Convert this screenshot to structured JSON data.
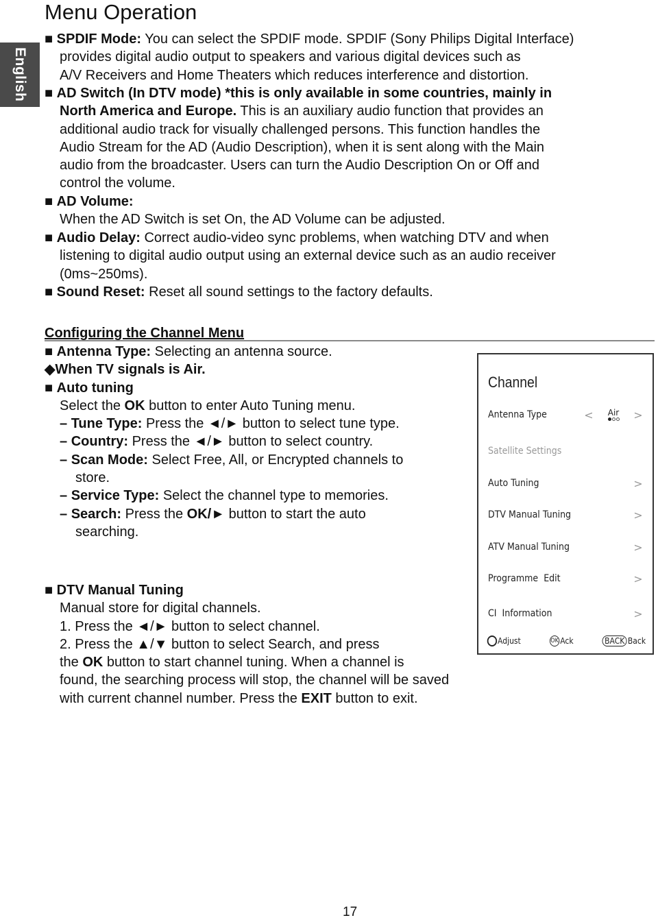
{
  "page": {
    "title": "Menu Operation",
    "language_tab": "English",
    "page_number": "17"
  },
  "sound_section": {
    "spdif": {
      "bullet": "■",
      "label": "SPDIF Mode:",
      "line1": " You can select the SPDIF mode. SPDIF (Sony Philips Digital Interface)",
      "line2": "provides digital audio output to speakers and various digital devices such as",
      "line3": "A/V Receivers and Home Theaters which reduces interference and distortion."
    },
    "ad_switch": {
      "bullet": "■",
      "label_line1": "AD Switch (In DTV mode) *this is only available in some countries, mainly in",
      "label_line2": "North America and Europe.",
      "line2_rest": " This is an auxiliary audio function that provides an",
      "line3": "additional audio track for visually challenged persons. This function handles the",
      "line4": "Audio Stream for the AD (Audio Description), when it is sent along with the Main",
      "line5": "audio from the broadcaster. Users can turn the Audio Description On or Off and",
      "line6": "control the volume."
    },
    "ad_volume": {
      "bullet": "■",
      "label": "AD Volume:",
      "text": "When the AD Switch is set On, the AD Volume can be adjusted."
    },
    "audio_delay": {
      "bullet": "■",
      "label": "Audio Delay:",
      "line1": " Correct audio-video sync problems, when watching DTV and when",
      "line2": "listening to digital audio output using an external device such as an audio receiver",
      "line3": "(0ms~250ms)."
    },
    "sound_reset": {
      "bullet": "■",
      "label": "Sound Reset:",
      "text": " Reset all sound settings to the factory defaults."
    }
  },
  "channel_section": {
    "heading": "Configuring the Channel Menu",
    "antenna_type": {
      "bullet": "■",
      "label": "Antenna Type:",
      "text": " Selecting an antenna source."
    },
    "air_note": {
      "bullet": "◆",
      "text": "When TV signals is Air."
    },
    "auto_tuning": {
      "bullet": "■",
      "label": "Auto tuning",
      "intro_pre": "Select the ",
      "intro_bold": "OK",
      "intro_post": " button to enter Auto Tuning menu.",
      "steps": [
        {
          "dash": "– ",
          "label": "Tune Type:",
          "text": " Press the ◄/► button to select tune type."
        },
        {
          "dash": "– ",
          "label": "Country:",
          "text": " Press the ◄/► button to select country."
        },
        {
          "dash": "– ",
          "label": "Scan Mode:",
          "text": " Select Free, All, or Encrypted channels to",
          "cont": "store."
        },
        {
          "dash": "– ",
          "label": "Service Type:",
          "text": " Select the channel type to memories."
        },
        {
          "dash": "– ",
          "label": "Search:",
          "text_pre": " Press the ",
          "text_bold": "OK/►",
          "text": " button to start the auto",
          "cont": "searching."
        }
      ]
    },
    "dtv_manual": {
      "bullet": "■",
      "label": "DTV Manual Tuning",
      "line1": "Manual store for digital channels.",
      "line2": "1. Press the ◄/► button to select channel.",
      "line3": "2. Press the ▲/▼ button to select Search, and press",
      "line4_pre": "the ",
      "line4_bold": "OK",
      "line4_post": " button to start channel tuning. When a channel is",
      "line5": "found, the searching process will stop, the channel will be saved",
      "line6_pre": "with current channel number. Press the ",
      "line6_bold": "EXIT",
      "line6_post": " button to exit."
    }
  },
  "tv_menu": {
    "title": "Channel",
    "items": [
      {
        "label": "Antenna Type",
        "value": "Air",
        "left_arrow": "<",
        "right_arrow": ">",
        "dots_total": 3,
        "dot_selected": 1
      },
      {
        "label": "Satellite Settings",
        "disabled": true
      },
      {
        "label": "Auto Tuning",
        "arrow": ">"
      },
      {
        "label": "DTV Manual Tuning",
        "arrow": ">"
      },
      {
        "label": "ATV Manual Tuning",
        "arrow": ">"
      },
      {
        "label": "Programme  Edit",
        "arrow": ">"
      },
      {
        "label": "CI  Information",
        "arrow": ">"
      }
    ],
    "footer": {
      "adjust": "Adjust",
      "ok_key": "OK",
      "ack": "Ack",
      "back_key": "BACK",
      "back": "Back"
    }
  }
}
